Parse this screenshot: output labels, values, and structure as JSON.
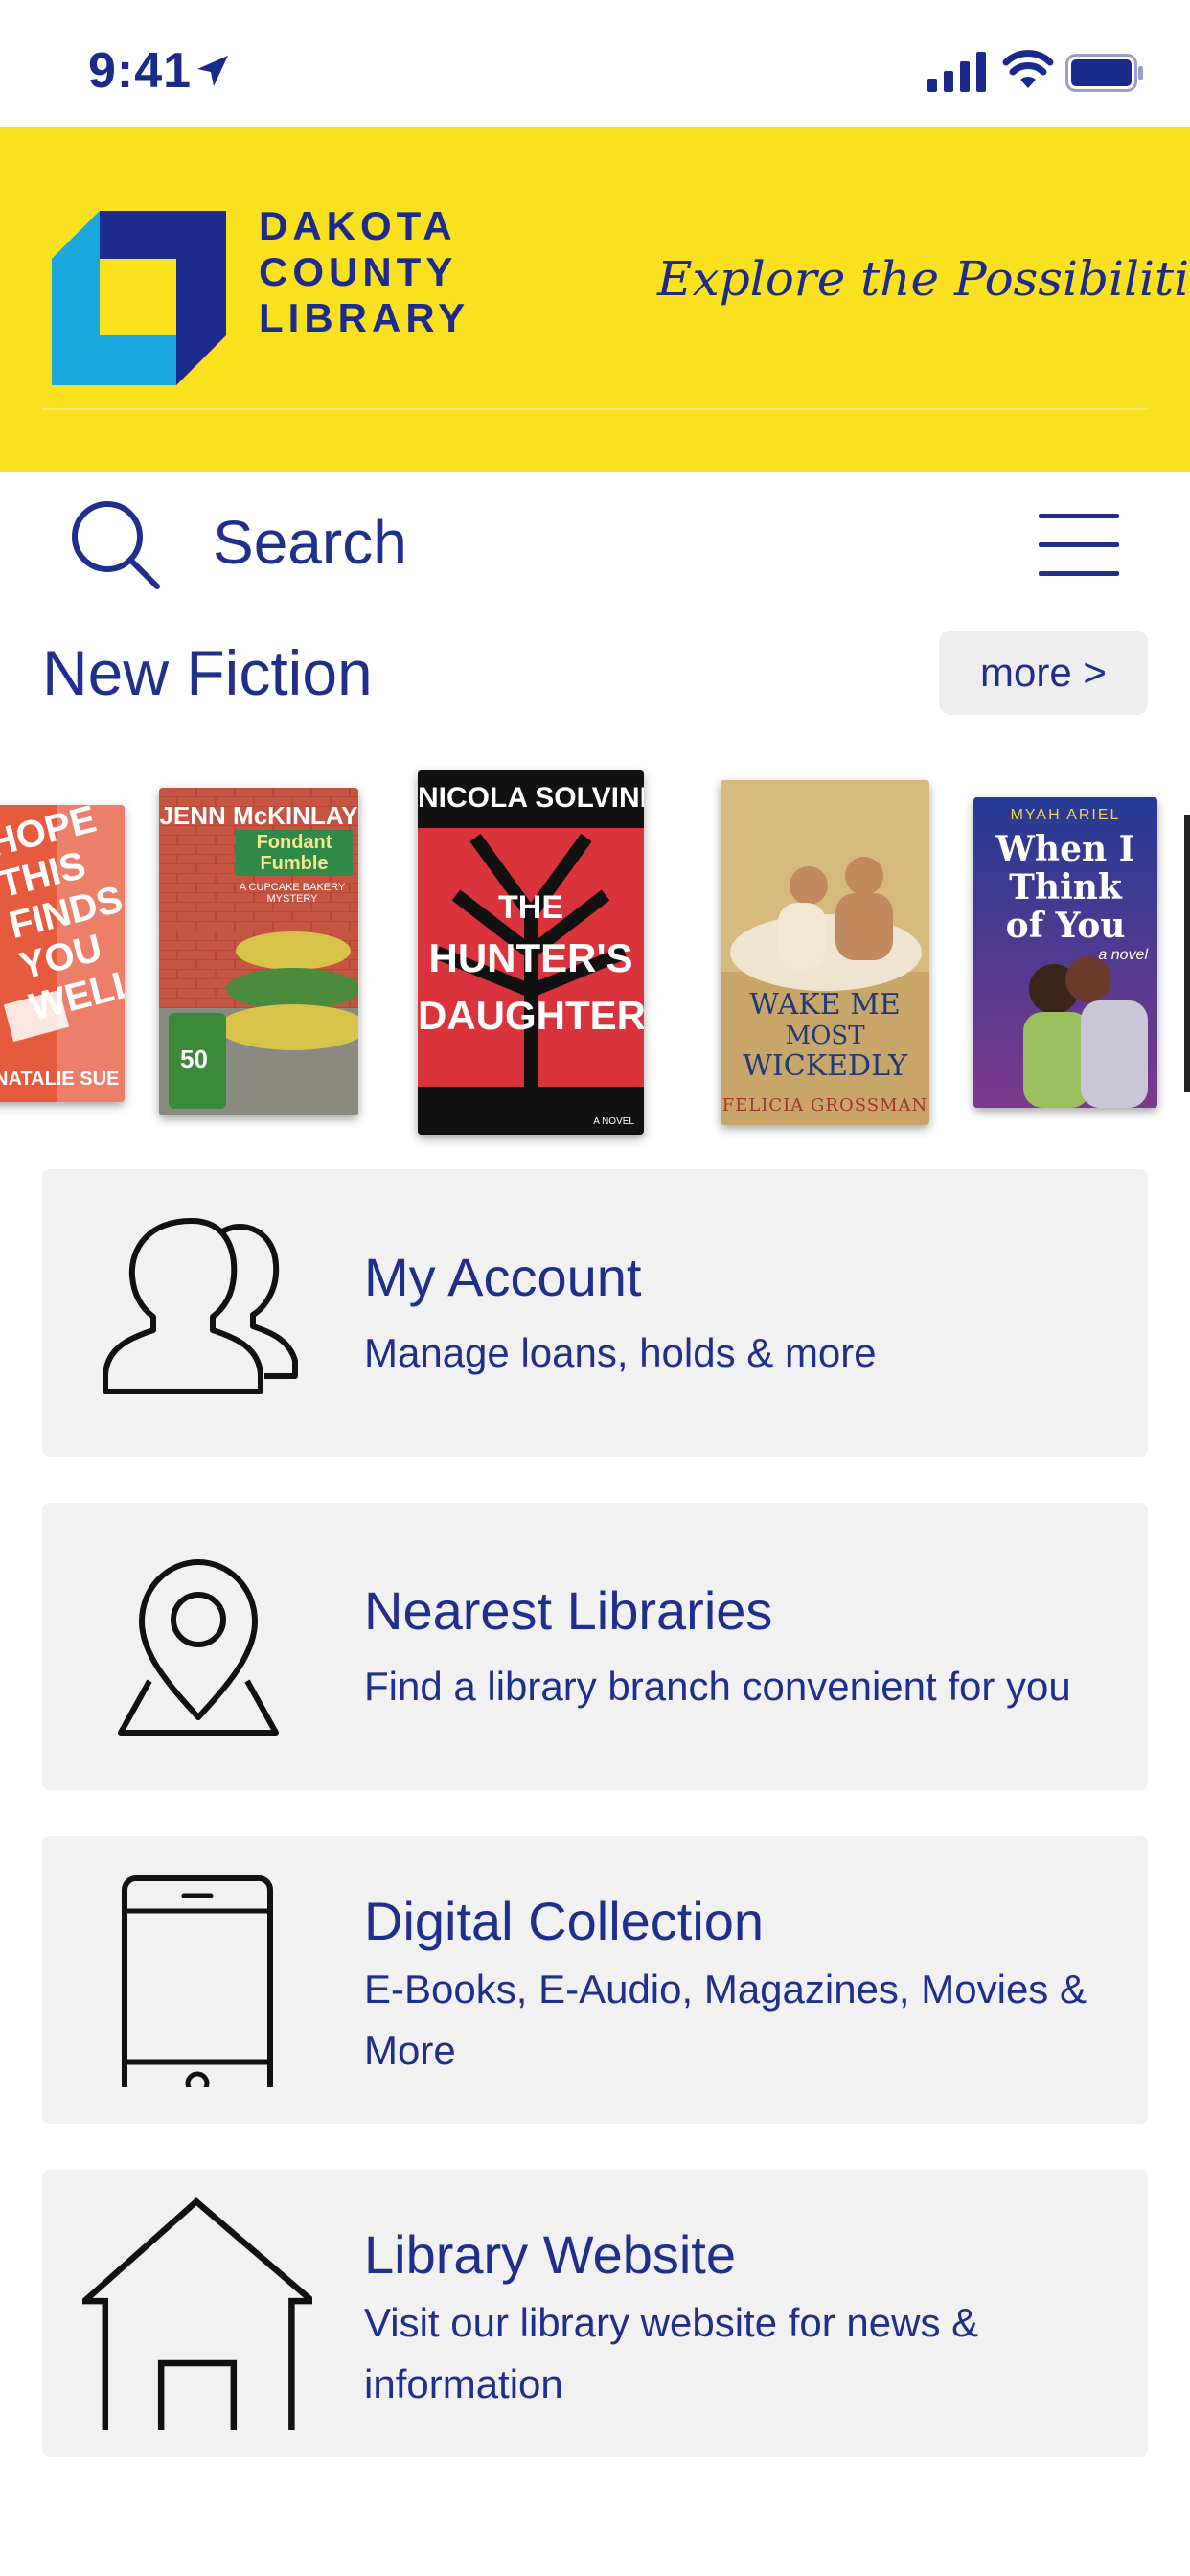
{
  "status_bar": {
    "time": "9:41"
  },
  "header": {
    "logo_lines": [
      "DAKOTA",
      "COUNTY",
      "LIBRARY"
    ],
    "tagline": "Explore the Possibilities",
    "colors": {
      "banner": "#f9e11f",
      "navy": "#1c2b8c",
      "cyan": "#1aa8dc"
    }
  },
  "search": {
    "placeholder": "Search"
  },
  "new_fiction": {
    "title": "New Fiction",
    "more_label": "more >",
    "books": [
      {
        "title_lines": [
          "HOPE",
          "THIS",
          "FINDS",
          "YOU",
          "WELL"
        ],
        "author": "NATALIE SUE"
      },
      {
        "author": "JENN McKINLAY",
        "title_lines": [
          "Fondant",
          "Fumble"
        ],
        "series": "A CUPCAKE BAKERY MYSTERY",
        "badge": "50"
      },
      {
        "author": "NICOLA SOLVINIC",
        "title_lines": [
          "THE",
          "HUNTER'S",
          "DAUGHTER"
        ],
        "footer": "A NOVEL"
      },
      {
        "title_lines": [
          "WAKE ME",
          "MOST",
          "WICKEDLY"
        ],
        "author": "FELICIA GROSSMAN"
      },
      {
        "author": "MYAH ARIEL",
        "title_lines": [
          "When I",
          "Think",
          "of You"
        ],
        "footer": "a novel"
      }
    ]
  },
  "menu": [
    {
      "icon": "people-icon",
      "title": "My Account",
      "subtitle": "Manage loans, holds & more"
    },
    {
      "icon": "map-pin-icon",
      "title": "Nearest Libraries",
      "subtitle": "Find a library branch convenient for you"
    },
    {
      "icon": "phone-icon",
      "title": "Digital Collection",
      "subtitle": "E-Books, E-Audio, Magazines, Movies & More"
    },
    {
      "icon": "house-icon",
      "title": "Library Website",
      "subtitle": "Visit our library website for news & information"
    }
  ]
}
